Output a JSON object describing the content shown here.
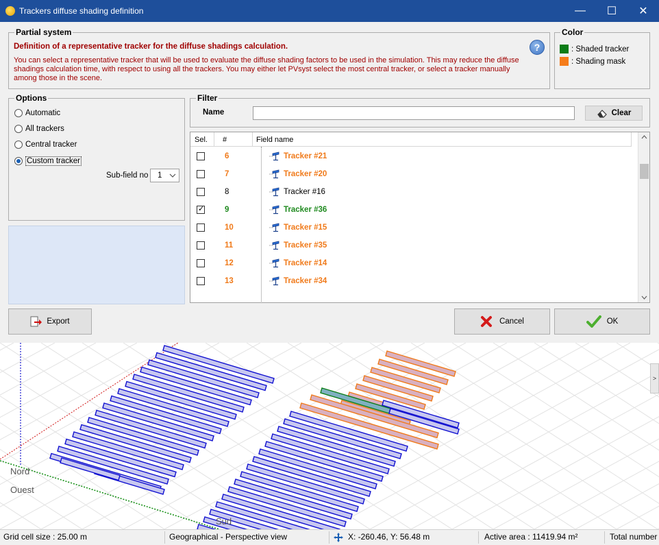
{
  "window": {
    "title": "Trackers diffuse shading definition",
    "minimize": "—",
    "maximize": "☐",
    "close": "✕"
  },
  "partial": {
    "group_title": "Partial system",
    "heading": "Definition of a representative tracker for the diffuse shadings calculation.",
    "text": "You can select a representative tracker that will be used to evaluate the diffuse shading factors to be used in the simulation. This may reduce the diffuse shadings calculation time, with respect to using all the trackers. You may either let PVsyst select the most central tracker, or select a tracker manually among those in the scene.",
    "help": "?"
  },
  "color": {
    "group_title": "Color",
    "items": [
      {
        "label": ": Shaded tracker",
        "color": "#0b7d17"
      },
      {
        "label": ": Shading mask",
        "color": "#f57c1a"
      }
    ]
  },
  "options": {
    "group_title": "Options",
    "items": [
      {
        "label": "Automatic",
        "selected": false
      },
      {
        "label": "All trackers",
        "selected": false
      },
      {
        "label": "Central tracker",
        "selected": false
      },
      {
        "label": "Custom tracker",
        "selected": true
      }
    ],
    "subfield_label": "Sub-field no",
    "subfield_value": "1"
  },
  "filter": {
    "group_title": "Filter",
    "name_label": "Name",
    "name_value": "",
    "clear_label": "Clear"
  },
  "grid": {
    "headers": {
      "sel": "Sel.",
      "num": "#",
      "field": "Field name"
    },
    "rows": [
      {
        "num": "6",
        "name": "Tracker #21",
        "checked": false,
        "style": "orange"
      },
      {
        "num": "7",
        "name": "Tracker #20",
        "checked": false,
        "style": "orange"
      },
      {
        "num": "8",
        "name": "Tracker #16",
        "checked": false,
        "style": "plain"
      },
      {
        "num": "9",
        "name": "Tracker #36",
        "checked": true,
        "style": "green"
      },
      {
        "num": "10",
        "name": "Tracker #15",
        "checked": false,
        "style": "orange"
      },
      {
        "num": "11",
        "name": "Tracker #35",
        "checked": false,
        "style": "orange"
      },
      {
        "num": "12",
        "name": "Tracker #14",
        "checked": false,
        "style": "orange"
      },
      {
        "num": "13",
        "name": "Tracker #34",
        "checked": false,
        "style": "orange"
      }
    ]
  },
  "buttons": {
    "export": "Export",
    "cancel": "Cancel",
    "ok": "OK"
  },
  "scene": {
    "nord": "Nord",
    "ouest": "Ouest",
    "sud": "Sud",
    "side_tab": ">"
  },
  "status": {
    "grid_cell": "Grid cell size : 25.00 m",
    "view": "Geographical - Perspective view",
    "coords": "X: -260.46, Y: 56.48 m",
    "active_area": "Active area : 11419.94 m²",
    "total": "Total number"
  }
}
